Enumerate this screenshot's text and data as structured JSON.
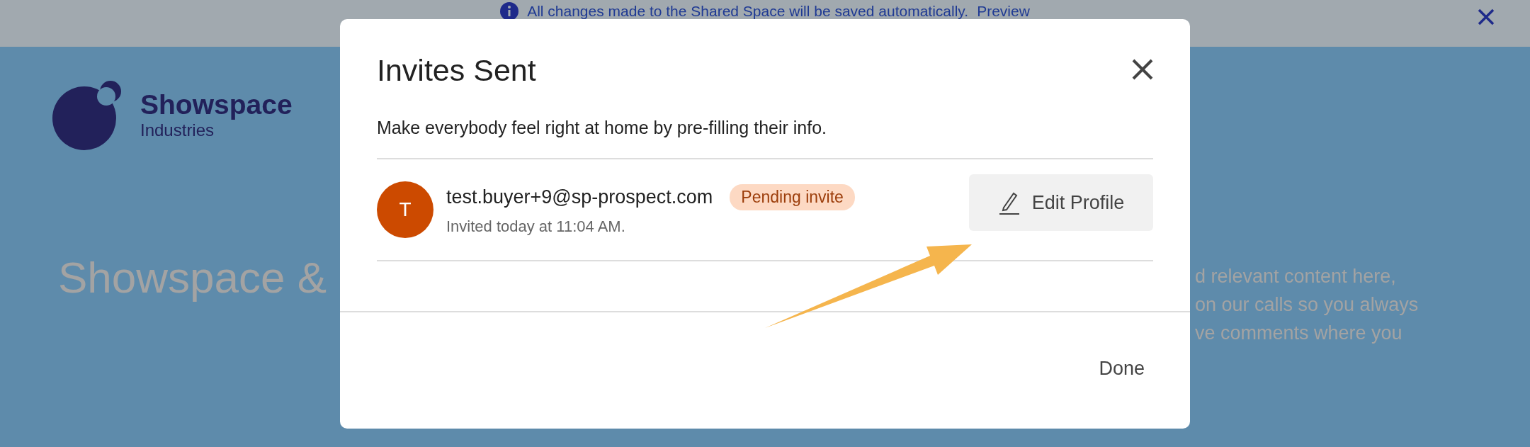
{
  "banner": {
    "message": "All changes made to the Shared Space will be saved automatically.",
    "link": "Preview"
  },
  "logo": {
    "name": "Showspace",
    "tagline": "Industries"
  },
  "background": {
    "heading": "Showspace &",
    "paragraph_lines": [
      "d relevant content here,",
      "on our calls so you always",
      "ve comments where you"
    ]
  },
  "dialog": {
    "title": "Invites Sent",
    "description": "Make everybody feel right at home by pre-filling their info.",
    "invites": [
      {
        "initial": "T",
        "email": "test.buyer+9@sp-prospect.com",
        "status": "Pending invite",
        "sent": "Invited today at 11:04 AM.",
        "action": "Edit Profile"
      }
    ],
    "buttons": [
      "Done"
    ]
  }
}
